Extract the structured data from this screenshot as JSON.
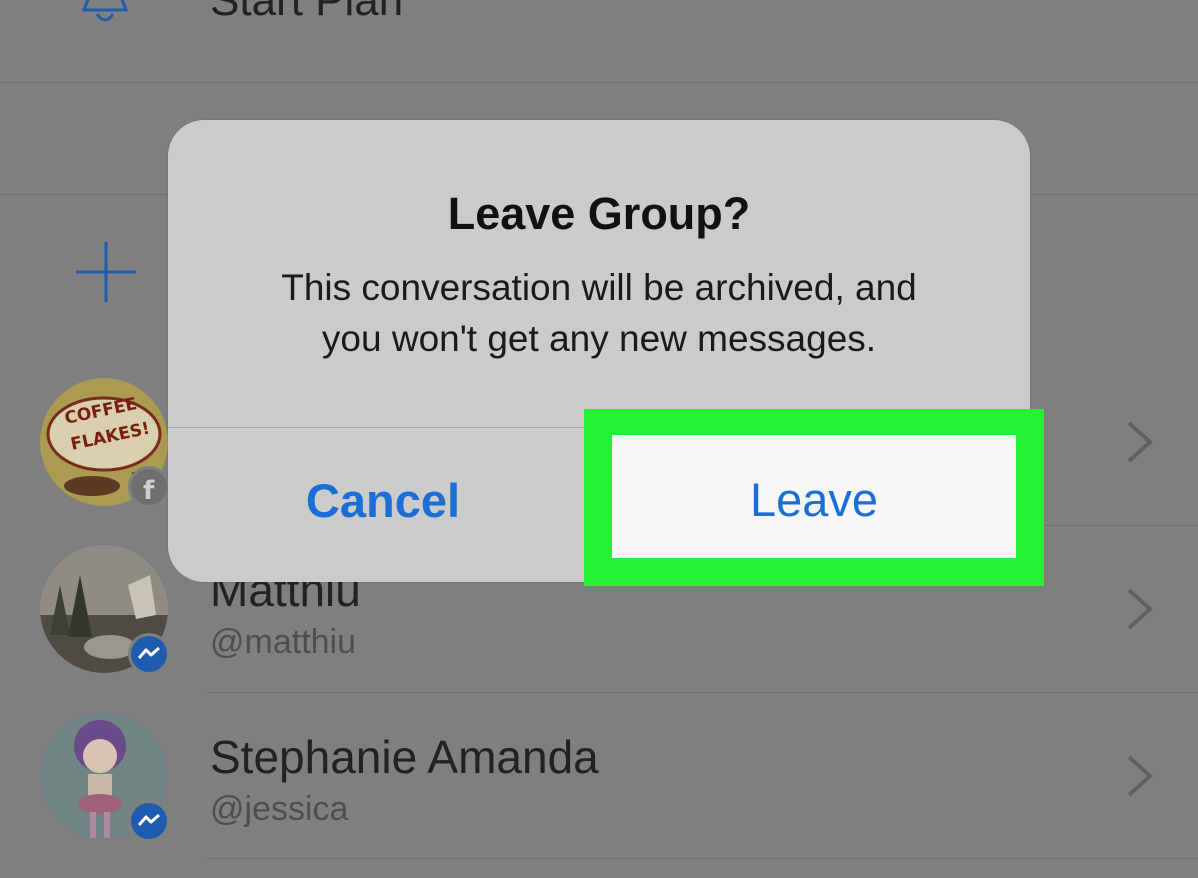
{
  "background_list": {
    "start_plan_label": "Start Plan",
    "contacts": [
      {
        "name": "",
        "handle": "",
        "avatar_text": [
          "COFFEE",
          "FLAKES!"
        ],
        "badge": "facebook-icon"
      },
      {
        "name": "Matthiu",
        "handle": "@matthiu",
        "badge": "messenger-icon"
      },
      {
        "name": "Stephanie Amanda",
        "handle": "@jessica",
        "badge": "messenger-icon"
      }
    ]
  },
  "dialog": {
    "title": "Leave Group?",
    "message_line1": "This conversation will be archived, and",
    "message_line2": "you won't get any new messages.",
    "cancel_label": "Cancel",
    "leave_label": "Leave"
  },
  "colors": {
    "accent_blue": "#1a6fd6",
    "highlight_green": "#22f233",
    "dim_background": "#7f7f7f",
    "dialog_background": "#cbcbcb"
  }
}
